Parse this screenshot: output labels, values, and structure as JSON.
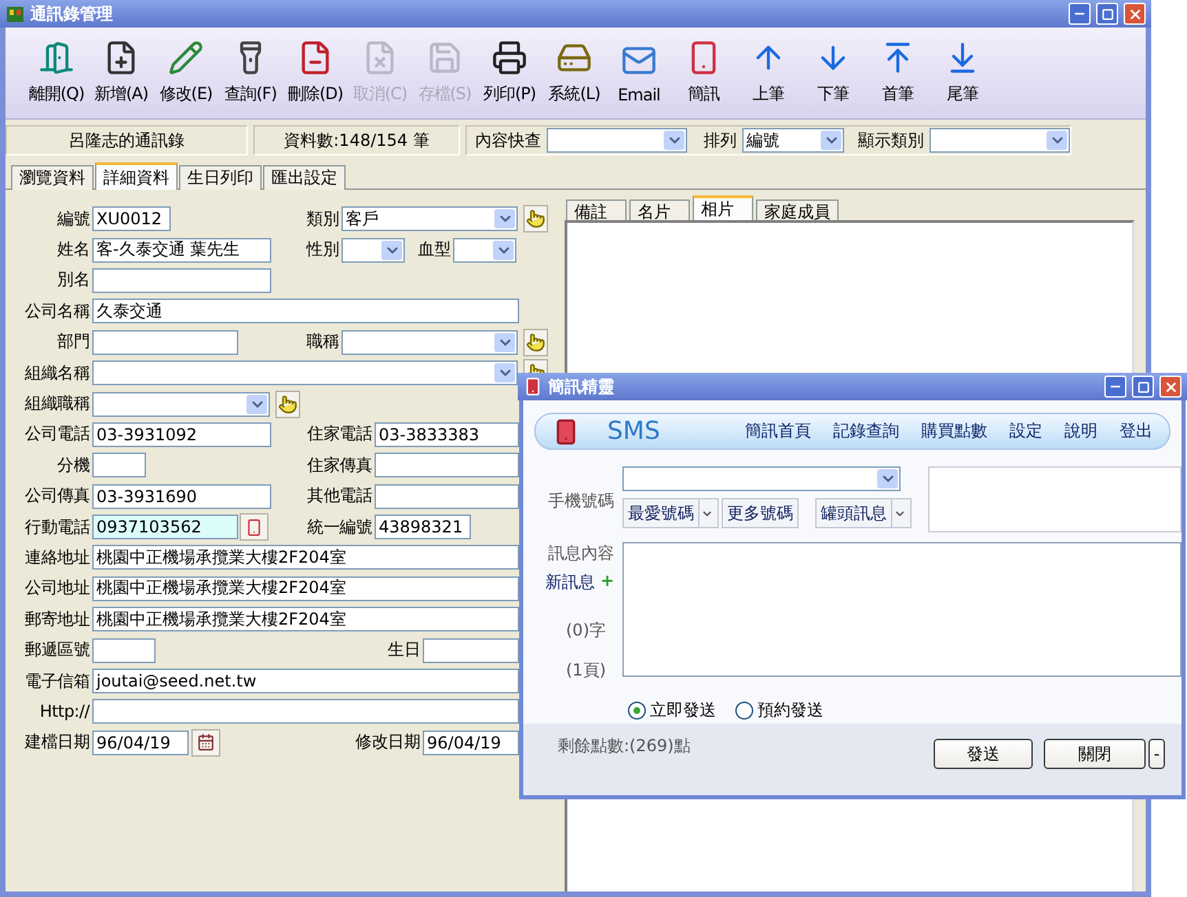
{
  "window": {
    "title": "通訊錄管理"
  },
  "toolbar": [
    {
      "label": "離開(Q)",
      "kind": "exit",
      "disabled": false
    },
    {
      "label": "新增(A)",
      "kind": "new",
      "disabled": false
    },
    {
      "label": "修改(E)",
      "kind": "edit",
      "disabled": false
    },
    {
      "label": "查詢(F)",
      "kind": "find",
      "disabled": false
    },
    {
      "label": "刪除(D)",
      "kind": "delete",
      "disabled": false
    },
    {
      "label": "取消(C)",
      "kind": "cancel",
      "disabled": true
    },
    {
      "label": "存檔(S)",
      "kind": "save",
      "disabled": true
    },
    {
      "label": "列印(P)",
      "kind": "print",
      "disabled": false
    },
    {
      "label": "系統(L)",
      "kind": "system",
      "disabled": false
    },
    {
      "label": "Email",
      "kind": "email",
      "disabled": false
    },
    {
      "label": "簡訊",
      "kind": "sms",
      "disabled": false
    },
    {
      "label": "上筆",
      "kind": "up",
      "disabled": false
    },
    {
      "label": "下筆",
      "kind": "down",
      "disabled": false
    },
    {
      "label": "首筆",
      "kind": "first",
      "disabled": false
    },
    {
      "label": "尾筆",
      "kind": "last",
      "disabled": false
    }
  ],
  "info_bar": {
    "book": "呂隆志的通訊錄",
    "count": "資料數:148/154 筆",
    "quick_search": {
      "label": "內容快查"
    },
    "sort": {
      "label": "排列",
      "value": "編號"
    },
    "category": {
      "label": "顯示類別"
    }
  },
  "tabs": [
    {
      "label": "瀏覽資料",
      "selected": false
    },
    {
      "label": "詳細資料",
      "selected": true
    },
    {
      "label": "生日列印",
      "selected": false
    },
    {
      "label": "匯出設定",
      "selected": false
    }
  ],
  "form": {
    "fields": [
      {
        "label": "編號",
        "value": "XU0012",
        "kind": "text",
        "highlighted": false
      },
      {
        "label": "類別",
        "value": "客戶",
        "kind": "select",
        "highlighted": false
      },
      {
        "label": "姓名",
        "value": "客-久泰交通 葉先生",
        "kind": "text",
        "highlighted": false
      },
      {
        "label": "性別",
        "kind": "select",
        "highlighted": false
      },
      {
        "label": "血型",
        "kind": "select",
        "highlighted": false
      },
      {
        "label": "別名",
        "kind": "text",
        "highlighted": false
      },
      {
        "label": "公司名稱",
        "value": "久泰交通",
        "kind": "text",
        "highlighted": false
      },
      {
        "label": "部門",
        "kind": "text",
        "highlighted": false
      },
      {
        "label": "職稱",
        "kind": "select",
        "highlighted": false
      },
      {
        "label": "組織名稱",
        "kind": "select",
        "highlighted": false
      },
      {
        "label": "組織職稱",
        "kind": "select",
        "highlighted": false
      },
      {
        "label": "公司電話",
        "value": "03-3931092",
        "kind": "text",
        "highlighted": false
      },
      {
        "label": "住家電話",
        "value": "03-3833383",
        "kind": "text",
        "highlighted": false
      },
      {
        "label": "分機",
        "kind": "text",
        "highlighted": false
      },
      {
        "label": "住家傳真",
        "kind": "text",
        "highlighted": false
      },
      {
        "label": "公司傳真",
        "value": "03-3931690",
        "kind": "text",
        "highlighted": false
      },
      {
        "label": "其他電話",
        "kind": "text",
        "highlighted": false
      },
      {
        "label": "行動電話",
        "value": "0937103562",
        "kind": "text",
        "highlighted": true
      },
      {
        "label": "統一編號",
        "value": "43898321",
        "kind": "text",
        "highlighted": false
      },
      {
        "label": "連絡地址",
        "value": "桃園中正機場承攬業大樓2F204室",
        "kind": "text",
        "highlighted": false
      },
      {
        "label": "公司地址",
        "value": "桃園中正機場承攬業大樓2F204室",
        "kind": "text",
        "highlighted": false
      },
      {
        "label": "郵寄地址",
        "value": "桃園中正機場承攬業大樓2F204室",
        "kind": "text",
        "highlighted": false
      },
      {
        "label": "郵遞區號",
        "kind": "text",
        "highlighted": false
      },
      {
        "label": "生日",
        "kind": "text",
        "highlighted": false
      },
      {
        "label": "電子信箱",
        "value": "joutai@seed.net.tw",
        "kind": "text",
        "highlighted": false
      },
      {
        "label": "Http://",
        "kind": "text",
        "highlighted": false
      },
      {
        "label": "建檔日期",
        "value": "96/04/19",
        "kind": "text",
        "highlighted": false
      },
      {
        "label": "修改日期",
        "value": "96/04/19",
        "kind": "text",
        "highlighted": false
      }
    ]
  },
  "detail_tabs": [
    {
      "label": "備註",
      "selected": false
    },
    {
      "label": "名片",
      "selected": false
    },
    {
      "label": "相片",
      "selected": true
    },
    {
      "label": "家庭成員",
      "selected": false
    }
  ],
  "sms_window": {
    "title": "簡訊精靈",
    "logo": "SMS",
    "nav": [
      "簡訊首頁",
      "記錄查詢",
      "購買點數",
      "設定",
      "說明",
      "登出"
    ],
    "phone": {
      "label": "手機號碼"
    },
    "number_buttons": [
      {
        "label": "最愛號碼",
        "dropdown": true
      },
      {
        "label": "更多號碼",
        "dropdown": false
      },
      {
        "label": "罐頭訊息",
        "dropdown": true
      }
    ],
    "content_label": "訊息內容",
    "new_message": "新訊息",
    "plus": "+",
    "char_count": "(0)字",
    "page_count": "(1頁)",
    "send_modes": [
      {
        "label": "立即發送",
        "selected": true
      },
      {
        "label": "預約發送",
        "selected": false
      }
    ],
    "points": "剩餘點數:(269)點",
    "buttons": [
      "發送",
      "關閉",
      "-"
    ]
  }
}
